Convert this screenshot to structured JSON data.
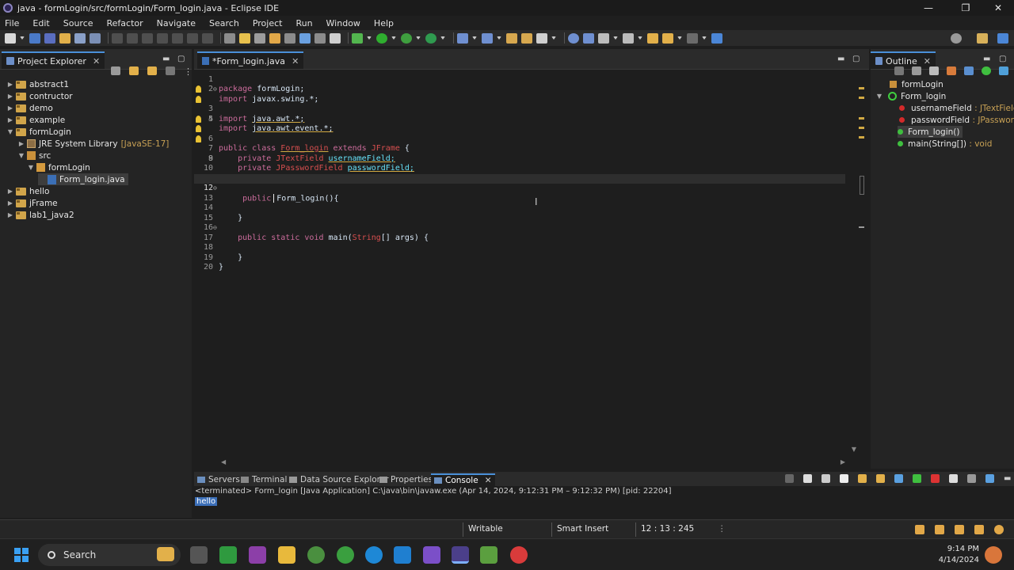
{
  "window": {
    "title": "java - formLogin/src/formLogin/Form_login.java - Eclipse IDE",
    "controls": {
      "minimize": "—",
      "maximize": "❐",
      "close": "✕"
    }
  },
  "menu": [
    "File",
    "Edit",
    "Source",
    "Refactor",
    "Navigate",
    "Search",
    "Project",
    "Run",
    "Window",
    "Help"
  ],
  "project_explorer": {
    "tab_label": "Project Explorer",
    "items": [
      {
        "label": "abstract1",
        "expanded": false
      },
      {
        "label": "contructor",
        "expanded": false
      },
      {
        "label": "demo",
        "expanded": false
      },
      {
        "label": "example",
        "expanded": false
      },
      {
        "label": "formLogin",
        "expanded": true
      },
      {
        "label": "JRE System Library",
        "suffix": "[JavaSE-17]"
      },
      {
        "label": "src",
        "expanded": true
      },
      {
        "label": "formLogin",
        "expanded": true
      },
      {
        "label": "Form_login.java",
        "selected": true
      },
      {
        "label": "hello",
        "expanded": false
      },
      {
        "label": "jFrame",
        "expanded": false
      },
      {
        "label": "lab1_java2",
        "expanded": false
      }
    ]
  },
  "editor": {
    "tab_label": "*Form_login.java",
    "lines": [
      {
        "n": "1",
        "text": "package formLogin;"
      },
      {
        "n": "2",
        "text": "import javax.swing.*;"
      },
      {
        "n": "3",
        "text": "import java.awt.*;"
      },
      {
        "n": "4",
        "text": "import java.awt.event.*;"
      },
      {
        "n": "5",
        "text": ""
      },
      {
        "n": "6",
        "text": "public class Form_login extends JFrame {"
      },
      {
        "n": "7",
        "text": "    private JTextField usernameField;"
      },
      {
        "n": "8",
        "text": "    private JPasswordField passwordField;"
      },
      {
        "n": "9",
        "text": ""
      },
      {
        "n": "10",
        "text": ""
      },
      {
        "n": "11",
        "text": ""
      },
      {
        "n": "12",
        "text": "     public  Form_login(){"
      },
      {
        "n": "13",
        "text": ""
      },
      {
        "n": "14",
        "text": "    }"
      },
      {
        "n": "15",
        "text": ""
      },
      {
        "n": "16",
        "text": "    public static void main(String[] args) {"
      },
      {
        "n": "17",
        "text": ""
      },
      {
        "n": "18",
        "text": "    }"
      },
      {
        "n": "19",
        "text": "}"
      },
      {
        "n": "20",
        "text": ""
      }
    ],
    "tokens": {
      "l1": [
        "package",
        "formLogin;"
      ],
      "l2": [
        "import",
        "javax.swing.*;"
      ],
      "l3": [
        "import",
        "java.awt.*;"
      ],
      "l4": [
        "import",
        "java.awt.event.*;"
      ],
      "l6": [
        "public",
        "class",
        "Form_login",
        "extends",
        "JFrame",
        "{"
      ],
      "l7": [
        "private",
        "JTextField",
        "usernameField;"
      ],
      "l8": [
        "private",
        "JPasswordField",
        "passwordField;"
      ],
      "l12": [
        "public",
        "Form_login(){"
      ],
      "l14": [
        "}"
      ],
      "l16": [
        "public",
        "static",
        "void",
        "main(",
        "String",
        "[] args) {"
      ],
      "l18": [
        "}"
      ],
      "l19": [
        "}"
      ]
    }
  },
  "outline": {
    "tab_label": "Outline",
    "items": [
      {
        "label": "formLogin"
      },
      {
        "label": "Form_login"
      },
      {
        "label": "usernameField",
        "type": ": JTextField"
      },
      {
        "label": "passwordField",
        "type": ": JPasswordField"
      },
      {
        "label": "Form_login()"
      },
      {
        "label": "main(String[])",
        "type": ": void"
      }
    ]
  },
  "console": {
    "tabs": [
      "Servers",
      "Terminal",
      "Data Source Explorer",
      "Properties",
      "Console"
    ],
    "active_tab": "Console",
    "info": "<terminated> Form_login [Java Application] C:\\java\\bin\\javaw.exe  (Apr 14, 2024, 9:12:31 PM – 9:12:32 PM) [pid: 22204]",
    "output": "hello"
  },
  "status": {
    "writable": "Writable",
    "insert_mode": "Smart Insert",
    "position": "12 : 13 : 245"
  },
  "taskbar": {
    "search_placeholder": "Search",
    "time": "9:14 PM",
    "date": "4/14/2024"
  },
  "colors": {
    "keyword": "#cc6c9c",
    "type": "#d84f4f",
    "field": "#66e1f8",
    "accent": "#4a90d9",
    "folder": "#d1a54a"
  }
}
